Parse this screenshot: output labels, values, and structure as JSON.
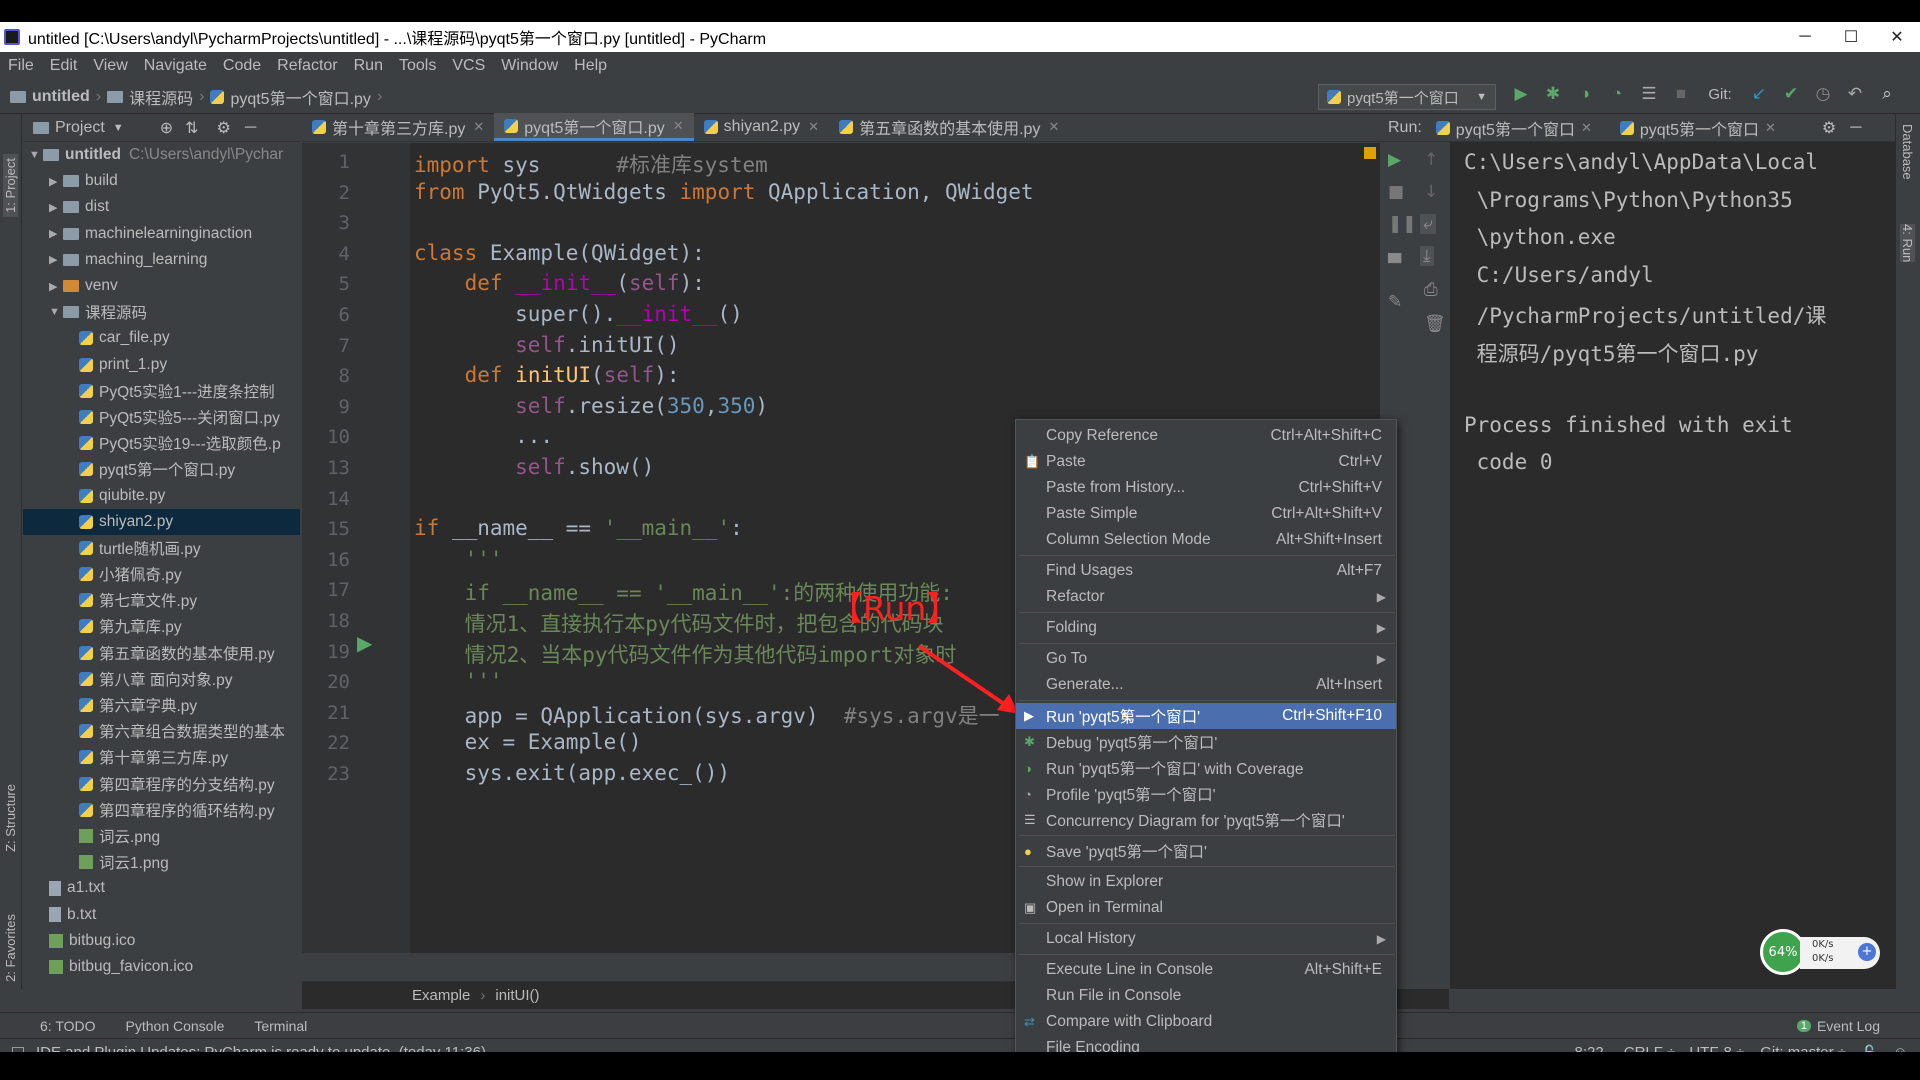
{
  "window": {
    "title": "untitled [C:\\Users\\andyl\\PycharmProjects\\untitled] - ...\\课程源码\\pyqt5第一个窗口.py [untitled] - PyCharm"
  },
  "menu": [
    "File",
    "Edit",
    "View",
    "Navigate",
    "Code",
    "Refactor",
    "Run",
    "Tools",
    "VCS",
    "Window",
    "Help"
  ],
  "nav": {
    "project": "untitled",
    "folder": "课程源码",
    "file": "pyqt5第一个窗口.py",
    "run_config": "pyqt5第一个窗口",
    "git_label": "Git:"
  },
  "left_strip": {
    "project_tab": "1: Project",
    "structure_tab": "Z: Structure",
    "favorites_tab": "2: Favorites"
  },
  "project_panel": {
    "title": "Project",
    "root_name": "untitled",
    "root_path": "C:\\Users\\andyl\\Pychar"
  },
  "tree": [
    {
      "name": "build",
      "type": "folder",
      "level": 1
    },
    {
      "name": "dist",
      "type": "folder",
      "level": 1
    },
    {
      "name": "machinelearninginaction",
      "type": "folder",
      "level": 1
    },
    {
      "name": "maching_learning",
      "type": "folder",
      "level": 1
    },
    {
      "name": "venv",
      "type": "folder-orange",
      "level": 1
    },
    {
      "name": "课程源码",
      "type": "folder-open",
      "level": 1
    },
    {
      "name": "car_file.py",
      "type": "py",
      "level": 2
    },
    {
      "name": "print_1.py",
      "type": "py",
      "level": 2
    },
    {
      "name": "PyQt5实验1---进度条控制",
      "type": "py",
      "level": 2
    },
    {
      "name": "PyQt5实验5---关闭窗口.py",
      "type": "py",
      "level": 2
    },
    {
      "name": "PyQt5实验19---选取颜色.p",
      "type": "py",
      "level": 2
    },
    {
      "name": "pyqt5第一个窗口.py",
      "type": "py",
      "level": 2
    },
    {
      "name": "qiubite.py",
      "type": "py",
      "level": 2
    },
    {
      "name": "shiyan2.py",
      "type": "py",
      "level": 2,
      "selected": true
    },
    {
      "name": "turtle随机画.py",
      "type": "py",
      "level": 2
    },
    {
      "name": "小猪佩奇.py",
      "type": "py",
      "level": 2
    },
    {
      "name": "第七章文件.py",
      "type": "py",
      "level": 2
    },
    {
      "name": "第九章库.py",
      "type": "py",
      "level": 2
    },
    {
      "name": "第五章函数的基本使用.py",
      "type": "py",
      "level": 2
    },
    {
      "name": "第八章 面向对象.py",
      "type": "py",
      "level": 2
    },
    {
      "name": "第六章字典.py",
      "type": "py",
      "level": 2
    },
    {
      "name": "第六章组合数据类型的基本",
      "type": "py",
      "level": 2
    },
    {
      "name": "第十章第三方库.py",
      "type": "py",
      "level": 2
    },
    {
      "name": "第四章程序的分支结构.py",
      "type": "py",
      "level": 2
    },
    {
      "name": "第四章程序的循环结构.py",
      "type": "py",
      "level": 2
    },
    {
      "name": "词云.png",
      "type": "img",
      "level": 2
    },
    {
      "name": "词云1.png",
      "type": "img",
      "level": 2
    },
    {
      "name": "a1.txt",
      "type": "txt",
      "level": 1
    },
    {
      "name": "b.txt",
      "type": "txt",
      "level": 1
    },
    {
      "name": "bitbug.ico",
      "type": "img",
      "level": 1
    },
    {
      "name": "bitbug_favicon.ico",
      "type": "img",
      "level": 1
    }
  ],
  "editor_tabs": [
    {
      "label": "第十章第三方库.py",
      "active": false
    },
    {
      "label": "pyqt5第一个窗口.py",
      "active": true
    },
    {
      "label": "shiyan2.py",
      "active": false
    },
    {
      "label": "第五章函数的基本使用.py",
      "active": false
    }
  ],
  "code_lines": [
    {
      "n": "1",
      "html": "<span class='kw'>import</span> sys      <span class='cm'>#标准库system</span>"
    },
    {
      "n": "2",
      "html": "<span class='kw'>from</span> PyQt5.QtWidgets <span class='kw'>import</span> QApplication, QWidget"
    },
    {
      "n": "3",
      "html": ""
    },
    {
      "n": "4",
      "html": "<span class='kw'>class</span> Example(QWidget):"
    },
    {
      "n": "5",
      "html": "    <span class='kw'>def</span> <span class='dunder'>__init__</span>(<span class='self'>self</span>):"
    },
    {
      "n": "6",
      "html": "        super().<span class='dunder'>__init__</span>()"
    },
    {
      "n": "7",
      "html": "        <span class='self'>self</span>.initUI()"
    },
    {
      "n": "8",
      "html": "    <span class='kw'>def</span> <span class='fn'>initUI</span>(<span class='self'>self</span>):"
    },
    {
      "n": "9",
      "html": "        <span class='self'>self</span>.resize(<span class='num'>350</span>,<span class='num'>350</span>)"
    },
    {
      "n": "10",
      "html": "        ..."
    },
    {
      "n": "13",
      "html": "        <span class='self'>self</span>.show()"
    },
    {
      "n": "14",
      "html": ""
    },
    {
      "n": "15",
      "html": "<span class='kw'>if</span> __name__ == <span class='str'>'__main__'</span>:"
    },
    {
      "n": "16",
      "html": "    <span class='str'>'''</span>"
    },
    {
      "n": "17",
      "html": "    <span class='str'>if __name__ == '__main__':的两种使用功能:</span>"
    },
    {
      "n": "18",
      "html": "    <span class='str'>情况1、直接执行本py代码文件时，把包含的代码块</span>"
    },
    {
      "n": "19",
      "html": "    <span class='str'>情况2、当本py代码文件作为其他代码import对象时</span>"
    },
    {
      "n": "20",
      "html": "    <span class='str'>'''</span>"
    },
    {
      "n": "21",
      "html": "    app = QApplication(sys.argv)  <span class='cm'>#sys.argv是一</span>"
    },
    {
      "n": "22",
      "html": "    ex = Example()"
    },
    {
      "n": "23",
      "html": "    sys.exit(app.exec_())"
    }
  ],
  "editor_breadcrumb": {
    "cls": "Example",
    "method": "initUI()"
  },
  "run_panel": {
    "label": "Run:",
    "tab1": "pyqt5第一个窗口",
    "tab2": "pyqt5第一个窗口"
  },
  "console_lines": [
    "C:\\Users\\andyl\\AppData\\Local",
    " \\Programs\\Python\\Python35",
    " \\python.exe",
    " C:/Users/andyl",
    " /PycharmProjects/untitled/课",
    " 程源码/pyqt5第一个窗口.py",
    "",
    "Process finished with exit",
    " code 0"
  ],
  "right_strip": {
    "database": "Database",
    "run": "4: Run"
  },
  "context_menu": [
    {
      "label": "Copy Reference",
      "shortcut": "Ctrl+Alt+Shift+C"
    },
    {
      "label": "Paste",
      "shortcut": "Ctrl+V",
      "icon": "paste-icon"
    },
    {
      "label": "Paste from History...",
      "shortcut": "Ctrl+Shift+V"
    },
    {
      "label": "Paste Simple",
      "shortcut": "Ctrl+Alt+Shift+V"
    },
    {
      "label": "Column Selection Mode",
      "shortcut": "Alt+Shift+Insert"
    },
    {
      "sep": true
    },
    {
      "label": "Find Usages",
      "shortcut": "Alt+F7"
    },
    {
      "label": "Refactor",
      "sub": true
    },
    {
      "sep": true
    },
    {
      "label": "Folding",
      "sub": true
    },
    {
      "sep": true
    },
    {
      "label": "Go To",
      "sub": true
    },
    {
      "label": "Generate...",
      "shortcut": "Alt+Insert"
    },
    {
      "sep": true
    },
    {
      "label": "Run 'pyqt5第一个窗口'",
      "shortcut": "Ctrl+Shift+F10",
      "highlight": true,
      "icon": "run-icon"
    },
    {
      "label": "Debug 'pyqt5第一个窗口'",
      "icon": "debug-icon"
    },
    {
      "label": "Run 'pyqt5第一个窗口' with Coverage",
      "icon": "coverage-icon"
    },
    {
      "label": "Profile 'pyqt5第一个窗口'",
      "icon": "profile-icon"
    },
    {
      "label": "Concurrency Diagram for 'pyqt5第一个窗口'",
      "icon": "concurrency-icon"
    },
    {
      "sep": true
    },
    {
      "label": "Save 'pyqt5第一个窗口'",
      "icon": "python-icon"
    },
    {
      "sep": true
    },
    {
      "label": "Show in Explorer"
    },
    {
      "label": "Open in Terminal",
      "icon": "terminal-icon"
    },
    {
      "sep": true
    },
    {
      "label": "Local History",
      "sub": true
    },
    {
      "sep": true
    },
    {
      "label": "Execute Line in Console",
      "shortcut": "Alt+Shift+E"
    },
    {
      "label": "Run File in Console"
    },
    {
      "label": "Compare with Clipboard",
      "icon": "compare-icon"
    },
    {
      "label": "File Encoding"
    }
  ],
  "annotation": {
    "text": "【Run】",
    "color": "#ff2020"
  },
  "bottom_tools": {
    "todo": "6: TODO",
    "python_console": "Python Console",
    "terminal": "Terminal",
    "event_log": "Event Log",
    "event_count": "1"
  },
  "status": {
    "message": "IDE and Plugin Updates: PyCharm is ready to update. (today 11:36)",
    "position": "8:22",
    "line_sep": "CRLF ÷",
    "encoding": "UTF-8 ÷",
    "git": "Git: master ÷"
  },
  "net_meter": {
    "percent": "64%",
    "up": "0K/s",
    "down": "0K/s"
  },
  "colors": {
    "accent": "#4b6eaf",
    "editor_bg": "#2b2b2b",
    "panel_bg": "#3c3f41"
  }
}
